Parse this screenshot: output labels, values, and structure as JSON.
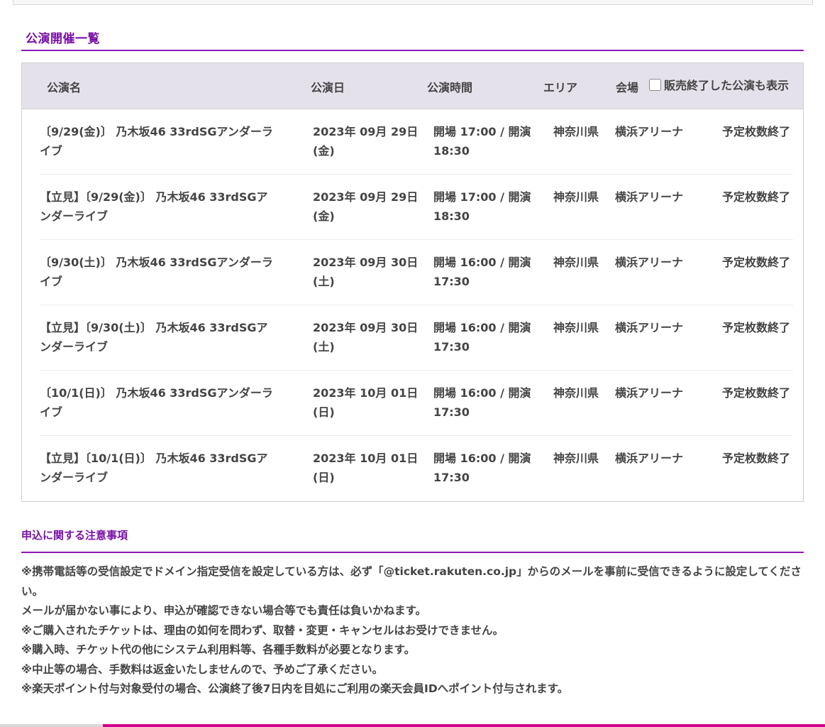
{
  "performances": {
    "title": "公演開催一覧",
    "headers": {
      "name": "公演名",
      "date": "公演日",
      "time": "公演時間",
      "area": "エリア",
      "venue": "会場",
      "show_ended_label": "販売終了した公演も表示"
    },
    "rows": [
      {
        "name": "〔9/29(金)〕 乃木坂46 33rdSGアンダーライブ",
        "date": "2023年 09月 29日 (金)",
        "time": "開場 17:00 / 開演 18:30",
        "area": "神奈川県",
        "venue": "横浜アリーナ",
        "status": "予定枚数終了"
      },
      {
        "name": "【立見】〔9/29(金)〕 乃木坂46 33rdSGアンダーライブ",
        "date": "2023年 09月 29日 (金)",
        "time": "開場 17:00 / 開演 18:30",
        "area": "神奈川県",
        "venue": "横浜アリーナ",
        "status": "予定枚数終了"
      },
      {
        "name": "〔9/30(土)〕 乃木坂46 33rdSGアンダーライブ",
        "date": "2023年 09月 30日 (土)",
        "time": "開場 16:00 / 開演 17:30",
        "area": "神奈川県",
        "venue": "横浜アリーナ",
        "status": "予定枚数終了"
      },
      {
        "name": "【立見】〔9/30(土)〕 乃木坂46 33rdSGアンダーライブ",
        "date": "2023年 09月 30日 (土)",
        "time": "開場 16:00 / 開演 17:30",
        "area": "神奈川県",
        "venue": "横浜アリーナ",
        "status": "予定枚数終了"
      },
      {
        "name": "〔10/1(日)〕 乃木坂46 33rdSGアンダーライブ",
        "date": "2023年 10月 01日 (日)",
        "time": "開場 16:00 / 開演 17:30",
        "area": "神奈川県",
        "venue": "横浜アリーナ",
        "status": "予定枚数終了"
      },
      {
        "name": "【立見】〔10/1(日)〕 乃木坂46 33rdSGアンダーライブ",
        "date": "2023年 10月 01日 (日)",
        "time": "開場 16:00 / 開演 17:30",
        "area": "神奈川県",
        "venue": "横浜アリーナ",
        "status": "予定枚数終了"
      }
    ]
  },
  "notes": {
    "title": "申込に関する注意事項",
    "lines": [
      "※携帯電話等の受信設定でドメイン指定受信を設定している方は、必ず「@ticket.rakuten.co.jp」からのメールを事前に受信できるように設定してください。",
      "メールが届かない事により、申込が確認できない場合等でも責任は負いかねます。",
      "※ご購入されたチケットは、理由の如何を問わず、取替・変更・キャンセルはお受けできません。",
      "※購入時、チケット代の他にシステム利用料等、各種手数料が必要となります。",
      "※中止等の場合、手数料は返金いたしませんので、予めご了承ください。",
      "※楽天ポイント付与対象受付の場合、公演終了後7日内を目処にご利用の楽天会員IDへポイント付与されます。"
    ]
  },
  "colors": {
    "accent": "#7a10a8",
    "header_bg": "#e5e1ea",
    "bottom_bar": "#d0008a"
  }
}
